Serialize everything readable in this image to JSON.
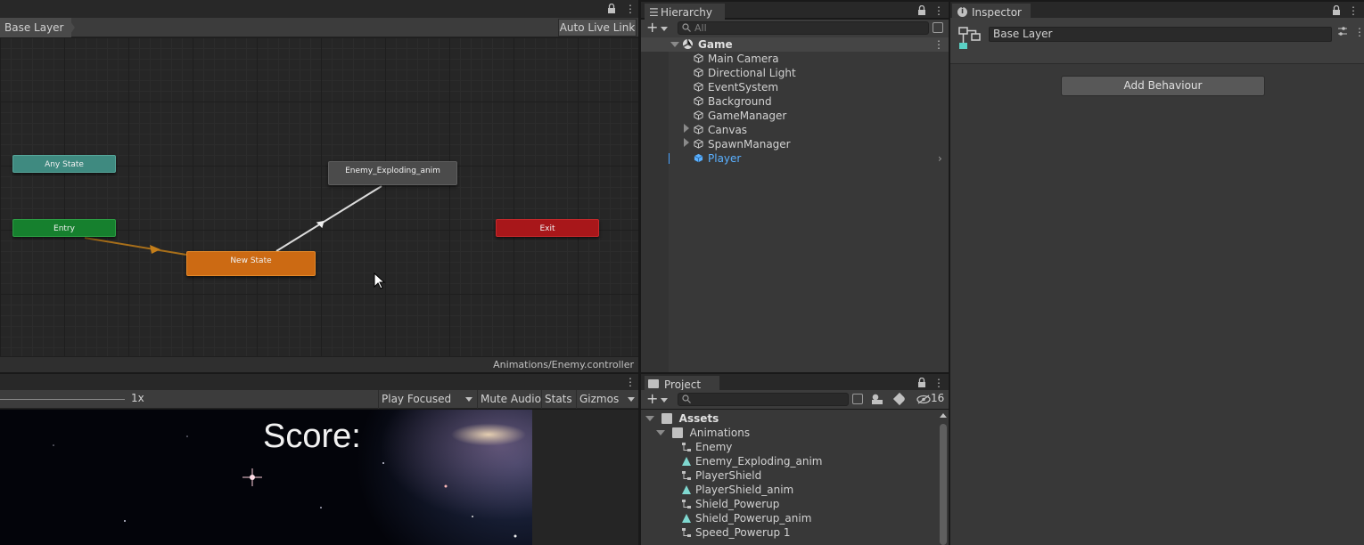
{
  "animator": {
    "layer_label": "Base Layer",
    "live_link_label": "Auto Live Link",
    "footer_path": "Animations/Enemy.controller",
    "states": {
      "any_state": "Any State",
      "entry": "Entry",
      "exploding": "Enemy_Exploding_anim",
      "new_state": "New State",
      "exit": "Exit"
    }
  },
  "game": {
    "speed_label": "1x",
    "play_focused": "Play Focused",
    "mute_audio": "Mute Audio",
    "stats": "Stats",
    "gizmos": "Gizmos",
    "score_text": "Score:"
  },
  "hierarchy": {
    "tab_label": "Hierarchy",
    "search_placeholder": "All",
    "scene_name": "Game",
    "objects": [
      "Main Camera",
      "Directional Light",
      "EventSystem",
      "Background",
      "GameManager",
      "Canvas",
      "SpawnManager",
      "Player"
    ]
  },
  "inspector": {
    "tab_label": "Inspector",
    "name_value": "Base Layer",
    "add_behaviour": "Add Behaviour"
  },
  "project": {
    "tab_label": "Project",
    "hidden_count": "16",
    "root_folder": "Assets",
    "subfolder": "Animations",
    "items": [
      "Enemy",
      "Enemy_Exploding_anim",
      "PlayerShield",
      "PlayerShield_anim",
      "Shield_Powerup",
      "Shield_Powerup_anim",
      "Speed_Powerup 1"
    ]
  },
  "colors": {
    "any_state": "#3f8a80",
    "entry": "#16802e",
    "new_state": "#cc6a13",
    "exit": "#a8171a",
    "default_state": "#4b4b4b",
    "selected_text": "#5ab0ff"
  }
}
